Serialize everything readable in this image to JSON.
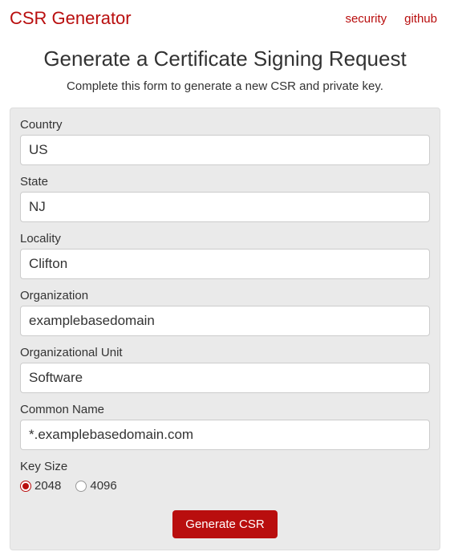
{
  "header": {
    "brand": "CSR Generator",
    "links": {
      "security": "security",
      "github": "github"
    }
  },
  "page": {
    "title": "Generate a Certificate Signing Request",
    "subtitle": "Complete this form to generate a new CSR and private key."
  },
  "form": {
    "country": {
      "label": "Country",
      "value": "US"
    },
    "state": {
      "label": "State",
      "value": "NJ"
    },
    "locality": {
      "label": "Locality",
      "value": "Clifton"
    },
    "organization": {
      "label": "Organization",
      "value": "examplebasedomain"
    },
    "organizational_unit": {
      "label": "Organizational Unit",
      "value": "Software"
    },
    "common_name": {
      "label": "Common Name",
      "value": "*.examplebasedomain.com"
    },
    "key_size": {
      "label": "Key Size",
      "options": {
        "opt2048": "2048",
        "opt4096": "4096"
      },
      "selected": "2048"
    },
    "submit_label": "Generate CSR"
  }
}
